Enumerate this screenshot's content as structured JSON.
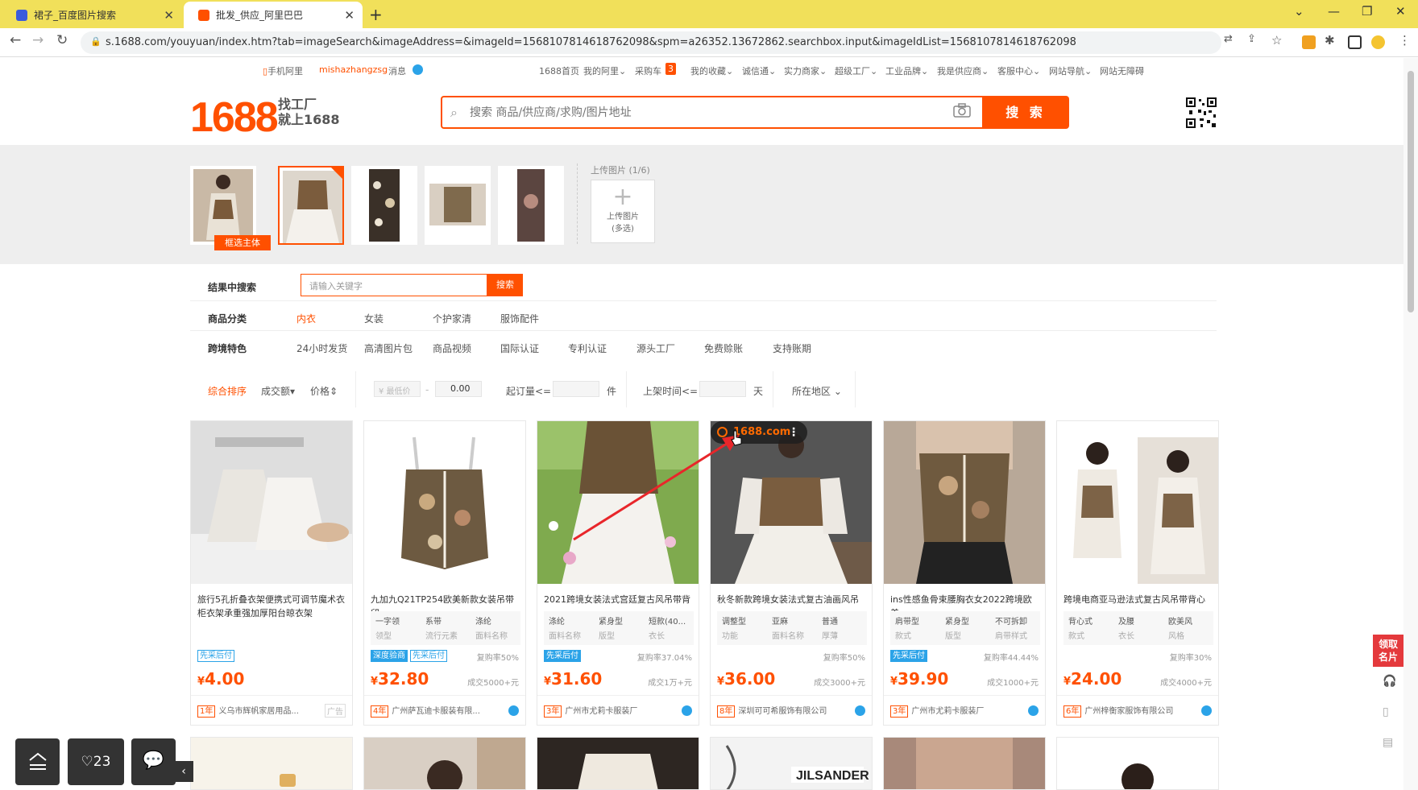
{
  "browser": {
    "tabs": [
      {
        "title": "裙子_百度图片搜索"
      },
      {
        "title": "批发_供应_阿里巴巴"
      }
    ],
    "url": "s.1688.com/youyuan/index.htm?tab=imageSearch&imageAddress=&imageId=1568107814618762098&spm=a26352.13672862.searchbox.input&imageIdList=1568107814618762098"
  },
  "topnav": {
    "mobile": "手机阿里",
    "user": "mishazhangzsg",
    "msg": "消息",
    "home": "1688首页",
    "my_ali": "我的阿里",
    "cart": "采购车",
    "cart_count": "3",
    "fav": "我的收藏",
    "trust": "诚信通",
    "strong": "实力商家",
    "factory": "超级工厂",
    "brand": "工业品牌",
    "supplier": "我是供应商",
    "service": "客服中心",
    "sitenav": "网站导航",
    "access": "网站无障碍"
  },
  "header": {
    "logo": "1688",
    "slogan": "找工厂\n就上1688",
    "search_placeholder": "搜索 商品/供应商/求购/图片地址",
    "search_btn": "搜 索"
  },
  "imagebar": {
    "select_subject": "框选主体",
    "upload_label": "上传图片 (1/6)",
    "upload_btn": "上传图片",
    "upload_sub": "(多选)"
  },
  "filters": {
    "in_result": "结果中搜索",
    "kw_placeholder": "请输入关键字",
    "kw_btn": "搜索",
    "category_label": "商品分类",
    "categories": [
      "内衣",
      "女装",
      "个护家清",
      "服饰配件"
    ],
    "feature_label": "跨境特色",
    "features": [
      "24小时发货",
      "高清图片包",
      "商品视频",
      "国际认证",
      "专利认证",
      "源头工厂",
      "免费赊账",
      "支持账期"
    ]
  },
  "sort": {
    "overall": "综合排序",
    "volume": "成交额",
    "price": "价格",
    "min_price": "¥ 最低价",
    "dash": "-",
    "max_price": "0.00",
    "moq": "起订量<=",
    "moq_unit": "件",
    "shelf": "上架时间<=",
    "shelf_unit": "天",
    "region": "所在地区"
  },
  "products": [
    {
      "title": "旅行5孔折叠衣架便携式可调节魔术衣柜衣架承重强加厚阳台晾衣架",
      "props": [],
      "tags": [
        "先采后付"
      ],
      "rebuy": "",
      "price": "4.00",
      "sold": "",
      "years": "1年",
      "supplier": "义乌市辉帆家居用品...",
      "ad": "广告"
    },
    {
      "title": "九加九Q21TP254欧美新款女装吊带印",
      "props": [
        {
          "v": "一字领",
          "k": "领型"
        },
        {
          "v": "系带",
          "k": "流行元素"
        },
        {
          "v": "涤纶",
          "k": "面料名称"
        }
      ],
      "tags": [
        "深度验商",
        "先采后付"
      ],
      "rebuy": "复购率50%",
      "price": "32.80",
      "sold": "成交5000+元",
      "years": "4年",
      "supplier": "广州萨瓦迪卡服装有限...",
      "ad": ""
    },
    {
      "title": "2021跨境女装法式宫廷复古风吊带背",
      "props": [
        {
          "v": "涤纶",
          "k": "面料名称"
        },
        {
          "v": "紧身型",
          "k": "版型"
        },
        {
          "v": "短款(40...",
          "k": "衣长"
        }
      ],
      "tags": [
        "先采后付"
      ],
      "rebuy": "复购率37.04%",
      "price": "31.60",
      "sold": "成交1万+元",
      "years": "3年",
      "supplier": "广州市尤莉卡服装厂",
      "ad": ""
    },
    {
      "title": "秋冬新款跨境女装法式复古油画风吊",
      "props": [
        {
          "v": "调整型",
          "k": "功能"
        },
        {
          "v": "亚麻",
          "k": "面料名称"
        },
        {
          "v": "普通",
          "k": "厚薄"
        }
      ],
      "tags": [],
      "rebuy": "复购率50%",
      "price": "36.00",
      "sold": "成交3000+元",
      "years": "8年",
      "supplier": "深圳可可希服饰有限公司",
      "ad": ""
    },
    {
      "title": "ins性感鱼骨束腰胸衣女2022跨境欧美",
      "props": [
        {
          "v": "肩带型",
          "k": "款式"
        },
        {
          "v": "紧身型",
          "k": "版型"
        },
        {
          "v": "不可拆卸",
          "k": "肩带样式"
        }
      ],
      "tags": [
        "先采后付"
      ],
      "rebuy": "复购率44.44%",
      "price": "39.90",
      "sold": "成交1000+元",
      "years": "3年",
      "supplier": "广州市尤莉卡服装厂",
      "ad": ""
    },
    {
      "title": "跨境电商亚马逊法式复古风吊带背心",
      "props": [
        {
          "v": "背心式",
          "k": "款式"
        },
        {
          "v": "及腰",
          "k": "衣长"
        },
        {
          "v": "欧美风",
          "k": "风格"
        }
      ],
      "tags": [],
      "rebuy": "复购率30%",
      "price": "24.00",
      "sold": "成交4000+元",
      "years": "6年",
      "supplier": "广州梓衡家服饰有限公司",
      "ad": ""
    }
  ],
  "overlay": {
    "text": "1688.com"
  },
  "bottom": {
    "likes": "23"
  },
  "side": {
    "card": "领取\n名片"
  },
  "colors": {
    "brand": "#ff5000",
    "tabbar": "#f1e05a",
    "tag": "#2ba3e8"
  }
}
